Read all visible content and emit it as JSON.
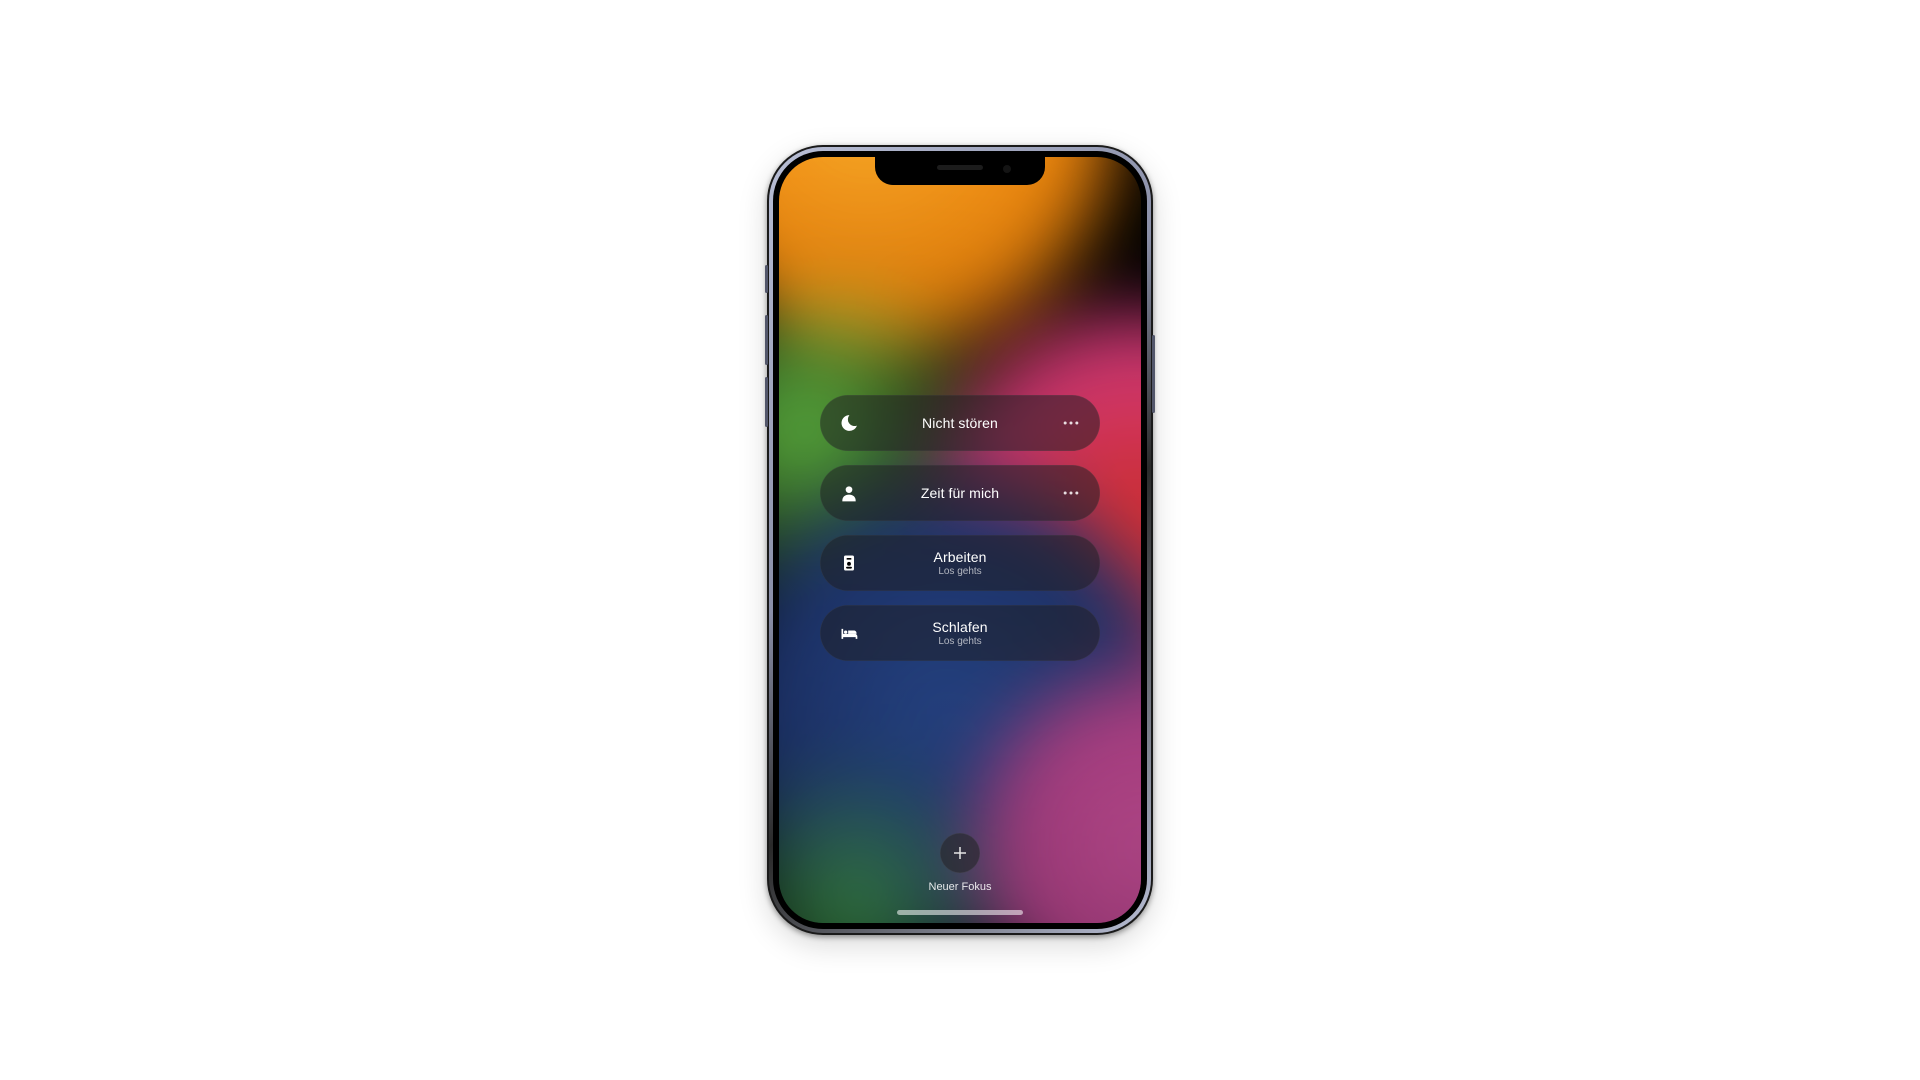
{
  "focus": {
    "items": [
      {
        "icon": "moon-icon",
        "label": "Nicht stören",
        "subtitle": null,
        "has_more": true
      },
      {
        "icon": "person-icon",
        "label": "Zeit für mich",
        "subtitle": null,
        "has_more": true
      },
      {
        "icon": "badge-icon",
        "label": "Arbeiten",
        "subtitle": "Los gehts",
        "has_more": false
      },
      {
        "icon": "bed-icon",
        "label": "Schlafen",
        "subtitle": "Los gehts",
        "has_more": false
      }
    ],
    "new_label": "Neuer Fokus"
  }
}
